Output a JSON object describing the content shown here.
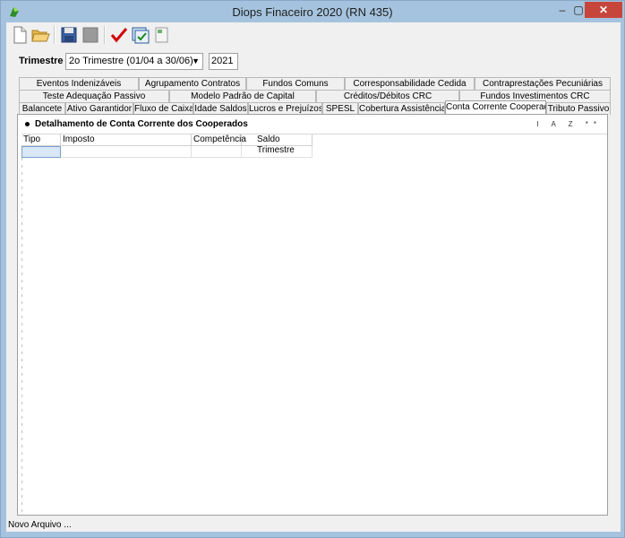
{
  "window": {
    "title": "Diops Finaceiro 2020 (RN 435)"
  },
  "toolbar": {
    "icons": [
      "new-file-icon",
      "open-folder-icon",
      "save-disk-icon",
      "save-disabled-icon",
      "check-icon",
      "validate-icon",
      "export-icon"
    ]
  },
  "filter": {
    "trimestre_label": "Trimestre",
    "trimestre_value": "2o Trimestre (01/04 a 30/06)",
    "year_value": "2021"
  },
  "tabs": {
    "row1": [
      "Eventos Indenizáveis",
      "Agrupamento Contratos",
      "Fundos Comuns",
      "Corresponsabilidade Cedida",
      "Contraprestações Pecuniárias"
    ],
    "row2": [
      "Teste Adequação Passivo",
      "Modelo Padrão de Capital",
      "Créditos/Débitos CRC",
      "Fundos Investimentos CRC"
    ],
    "row3": [
      "Balancete",
      "Ativo Garantidor",
      "Fluxo de Caixa",
      "Idade Saldos",
      "Lucros e Prejuízos",
      "SPESL",
      "Cobertura Assistêncial",
      "Conta Corrente Cooperado",
      "Tributo Passivo"
    ],
    "active": "Conta Corrente Cooperado"
  },
  "panel": {
    "title": "Detalhamento de Conta Corrente dos Cooperados",
    "header_icons": "I A Z **"
  },
  "grid": {
    "columns": [
      "Tipo",
      "Imposto",
      "Competência",
      "Saldo Trimestre"
    ]
  },
  "status": {
    "text": "Novo Arquivo ..."
  },
  "colors": {
    "titlebar": "#a5c3de",
    "close": "#c7463b",
    "accent_check": "#d10000"
  }
}
